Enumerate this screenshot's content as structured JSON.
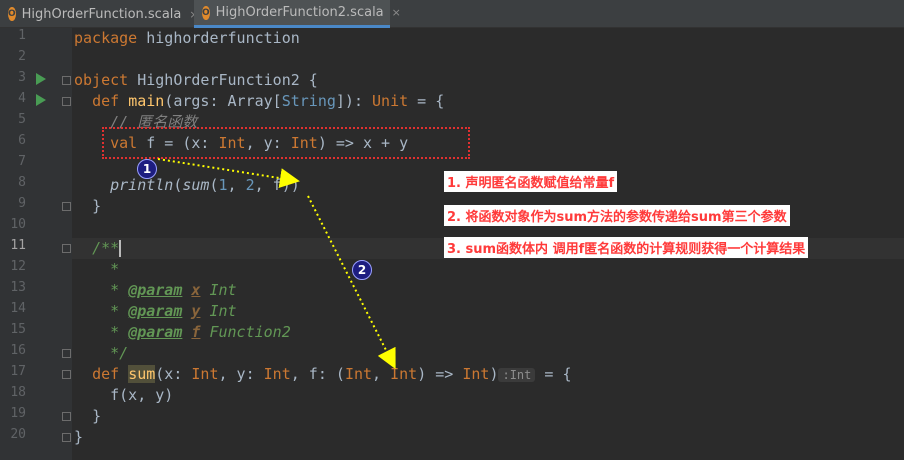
{
  "tabs": [
    {
      "label": "HighOrderFunction.scala",
      "close": "×",
      "icon": "scala-object-icon"
    },
    {
      "label": "HighOrderFunction2.scala",
      "close": "×",
      "icon": "scala-object-icon"
    }
  ],
  "line_numbers": [
    "1",
    "2",
    "3",
    "4",
    "5",
    "6",
    "7",
    "8",
    "9",
    "10",
    "11",
    "12",
    "13",
    "14",
    "15",
    "16",
    "17",
    "18",
    "19",
    "20"
  ],
  "code": {
    "l1": {
      "kw": "package",
      "rest": " highorderfunction"
    },
    "l3": {
      "kw": "object",
      "name": " HighOrderFunction2 {"
    },
    "l4": {
      "kw": "def",
      "fn": "main",
      "p1": "(args: Array[",
      "ty": "String",
      "p2": "]): ",
      "kw2": "Unit",
      "p3": " = {"
    },
    "l5": {
      "comment": "// 匿名函数"
    },
    "l6": {
      "kw": "val",
      "p1": " f = (x: ",
      "kw2": "Int",
      "p2": ", y: ",
      "kw3": "Int",
      "p3": ") => x + y"
    },
    "l8": {
      "fn1": "println",
      "p1": "(",
      "fn2": "sum",
      "p2": "(",
      "n1": "1",
      "p3": ", ",
      "n2": "2",
      "p4": ", f))"
    },
    "l9": {
      "text": "}"
    },
    "l11": {
      "text": "/**"
    },
    "l12": {
      "text": "*"
    },
    "l13": {
      "star": "* ",
      "tag": "@param",
      "name": "x",
      "type": "Int"
    },
    "l14": {
      "star": "* ",
      "tag": "@param",
      "name": "y",
      "type": "Int"
    },
    "l15": {
      "star": "* ",
      "tag": "@param",
      "name": "f",
      "type": "Function2"
    },
    "l16": {
      "text": "*/"
    },
    "l17": {
      "kw": "def",
      "fn": "sum",
      "p1": "(x: ",
      "k1": "Int",
      "p2": ", y: ",
      "k2": "Int",
      "p3": ", f: (",
      "k3": "Int",
      "p4": ", ",
      "k4": "Int",
      "p5": ") => ",
      "k5": "Int",
      "p6": ")",
      "hint": ":Int",
      "p7": " = {"
    },
    "l18": {
      "p1": "f(x",
      "p2": ", y)"
    },
    "l19": {
      "text": "}"
    },
    "l20": {
      "text": "}"
    }
  },
  "annotations": {
    "badge1": "1",
    "badge2": "2",
    "note1": "1. 声明匿名函数赋值给常量f",
    "note2": "2. 将函数对象作为sum方法的参数传递给sum第三个参数",
    "note3": "3. sum函数体内 调用f匿名函数的计算规则获得一个计算结果"
  },
  "colors": {
    "background": "#2b2b2b",
    "keyword": "#cc7832",
    "function": "#ffc66d",
    "annotation_text": "#ff3a3a",
    "arrow": "#ffff00"
  }
}
